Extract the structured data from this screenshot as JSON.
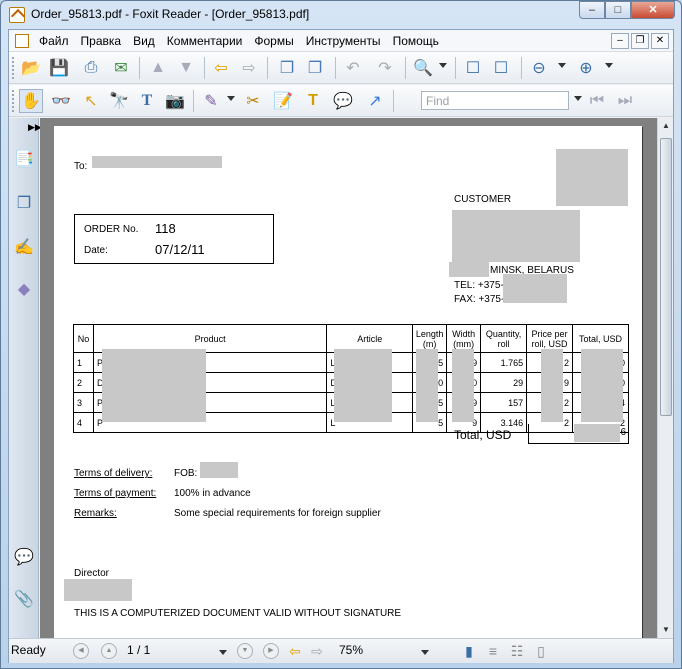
{
  "window": {
    "title": "Order_95813.pdf - Foxit Reader - [Order_95813.pdf]",
    "buttons": {
      "minimize": "–",
      "maximize": "□",
      "close": "✕"
    }
  },
  "menu": {
    "items": [
      "Файл",
      "Правка",
      "Вид",
      "Комментарии",
      "Формы",
      "Инструменты",
      "Помощь"
    ],
    "mdi": {
      "minimize": "–",
      "restore": "❐",
      "close": "✕"
    }
  },
  "toolbar": {
    "find_placeholder": "Find"
  },
  "document": {
    "to_label": "To:",
    "customer_label": "CUSTOMER",
    "order_no_label": "ORDER No.",
    "order_no": "118",
    "date_label": "Date:",
    "date": "07/12/11",
    "city": "MINSK, BELARUS",
    "tel": "TEL: +375-",
    "fax": "FAX: +375-",
    "table": {
      "headers": [
        "No",
        "Product",
        "Article",
        "Length (m)",
        "Width (mm)",
        "Quantity, roll",
        "Price per roll, USD",
        "Total, USD"
      ],
      "rows": [
        {
          "no": "1",
          "product": "P",
          "article": "L",
          "length": "5",
          "width": "9",
          "qty": "1.765",
          "price": "2",
          "total": "0"
        },
        {
          "no": "2",
          "product": "D",
          "article": "D",
          "length": "0",
          "width": "0",
          "qty": "29",
          "price": "9",
          "total": "0"
        },
        {
          "no": "3",
          "product": "P",
          "article": "L",
          "length": "5",
          "width": "9",
          "qty": "157",
          "price": "2",
          "total": "4"
        },
        {
          "no": "4",
          "product": "P",
          "article": "L",
          "length": "5",
          "width": "9",
          "qty": "3.146",
          "price": "2",
          "total": "2"
        }
      ],
      "total_label": "Total, USD",
      "total_value": "6"
    },
    "terms_delivery_label": "Terms of delivery:",
    "terms_delivery_value": "FOB: ",
    "terms_payment_label": "Terms of payment:",
    "terms_payment_value": "100% in advance",
    "remarks_label": "Remarks:",
    "remarks_value": "Some special requirements for foreign supplier",
    "director_label": "Director",
    "footer_note": "THIS IS A COMPUTERIZED DOCUMENT VALID WITHOUT SIGNATURE"
  },
  "statusbar": {
    "ready": "Ready",
    "page": "1 / 1",
    "zoom": "75%"
  },
  "colors": {
    "titlebar": "#c6daf0",
    "doc_background": "#808080",
    "redaction": "#c8c8c8"
  }
}
